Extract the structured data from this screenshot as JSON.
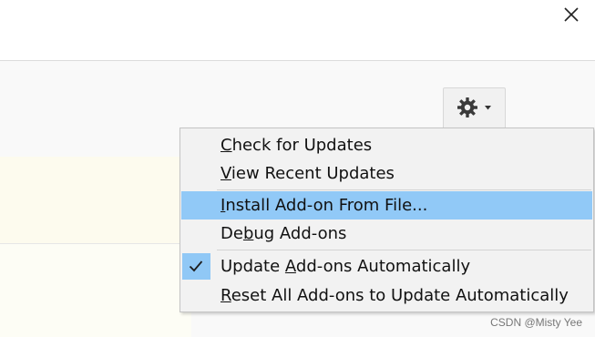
{
  "window": {
    "close_icon": "close-icon"
  },
  "toolbar": {
    "gear_icon": "gear-icon",
    "caret_icon": "chevron-down-icon"
  },
  "menu": {
    "items": [
      {
        "pre": "",
        "key": "C",
        "post": "heck for Updates",
        "highlighted": false,
        "checked": false
      },
      {
        "pre": "",
        "key": "V",
        "post": "iew Recent Updates",
        "highlighted": false,
        "checked": false
      },
      {
        "pre": "",
        "key": "I",
        "post": "nstall Add-on From File...",
        "highlighted": true,
        "checked": false
      },
      {
        "pre": "De",
        "key": "b",
        "post": "ug Add-ons",
        "highlighted": false,
        "checked": false
      },
      {
        "pre": "Update ",
        "key": "A",
        "post": "dd-ons Automatically",
        "highlighted": false,
        "checked": true
      },
      {
        "pre": "",
        "key": "R",
        "post": "eset All Add-ons to Update Automatically",
        "highlighted": false,
        "checked": false
      }
    ],
    "highlight_color": "#91c9f7"
  },
  "watermark": "CSDN @Misty Yee"
}
